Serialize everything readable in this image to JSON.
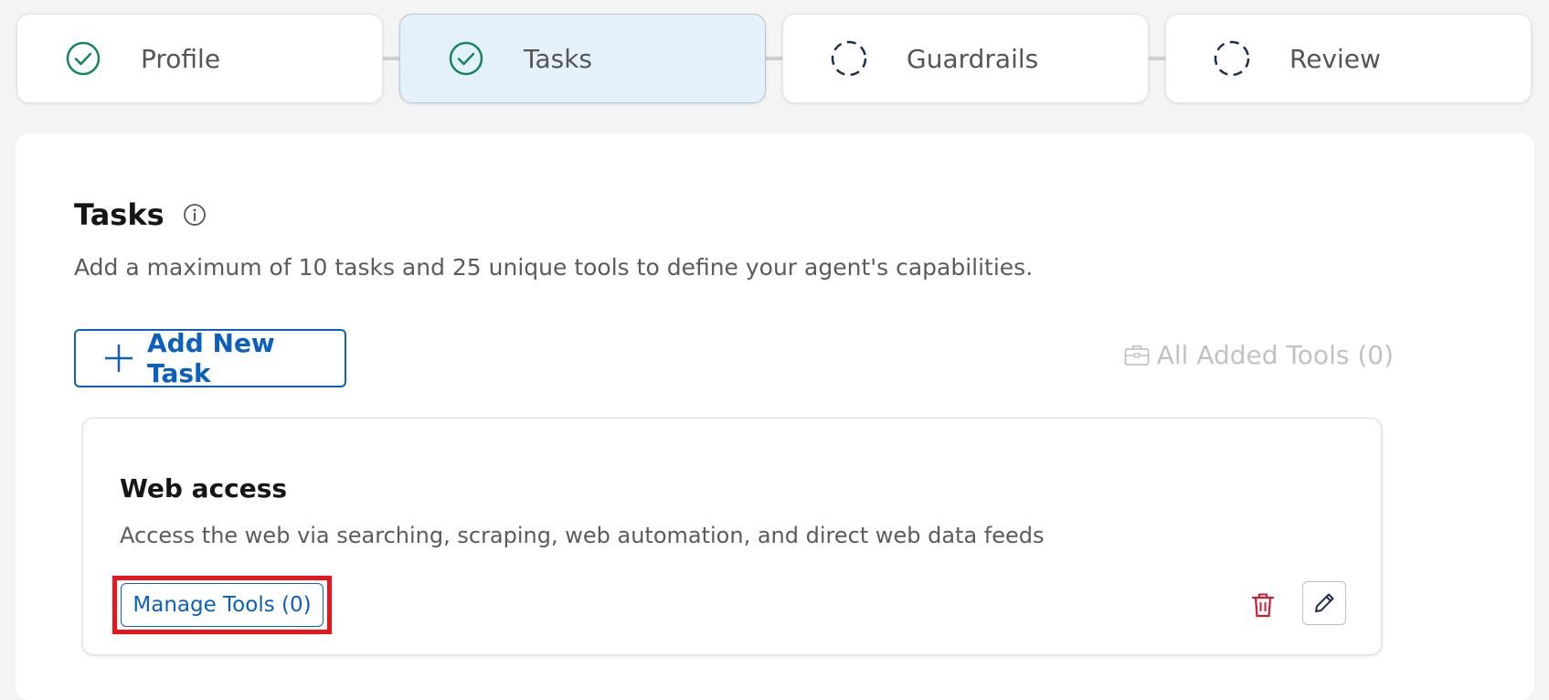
{
  "stepper": {
    "steps": [
      {
        "label": "Profile",
        "status": "complete",
        "icon": "check-circle-icon"
      },
      {
        "label": "Tasks",
        "status": "current-complete",
        "icon": "check-circle-icon"
      },
      {
        "label": "Guardrails",
        "status": "pending",
        "icon": "dashed-circle-icon"
      },
      {
        "label": "Review",
        "status": "pending",
        "icon": "dashed-circle-icon"
      }
    ]
  },
  "tasks_section": {
    "title": "Tasks",
    "info_icon": "info-icon",
    "description": "Add a maximum of 10 tasks and 25 unique tools to define your agent's capabilities.",
    "add_task_label": "Add New Task",
    "all_tools_label": "All Added Tools (0)"
  },
  "task_card": {
    "name": "Web access",
    "description": "Access the web via searching, scraping, web automation, and direct web data feeds",
    "manage_tools_label": "Manage Tools (0)",
    "delete_icon": "trash-icon",
    "edit_icon": "pencil-icon"
  },
  "colors": {
    "accent": "#0a5fbf",
    "success": "#13875a",
    "pending": "#1d2f4f",
    "danger": "#cc1f2f",
    "highlight": "#e8161b",
    "active_step_bg": "#e4f1fb"
  }
}
